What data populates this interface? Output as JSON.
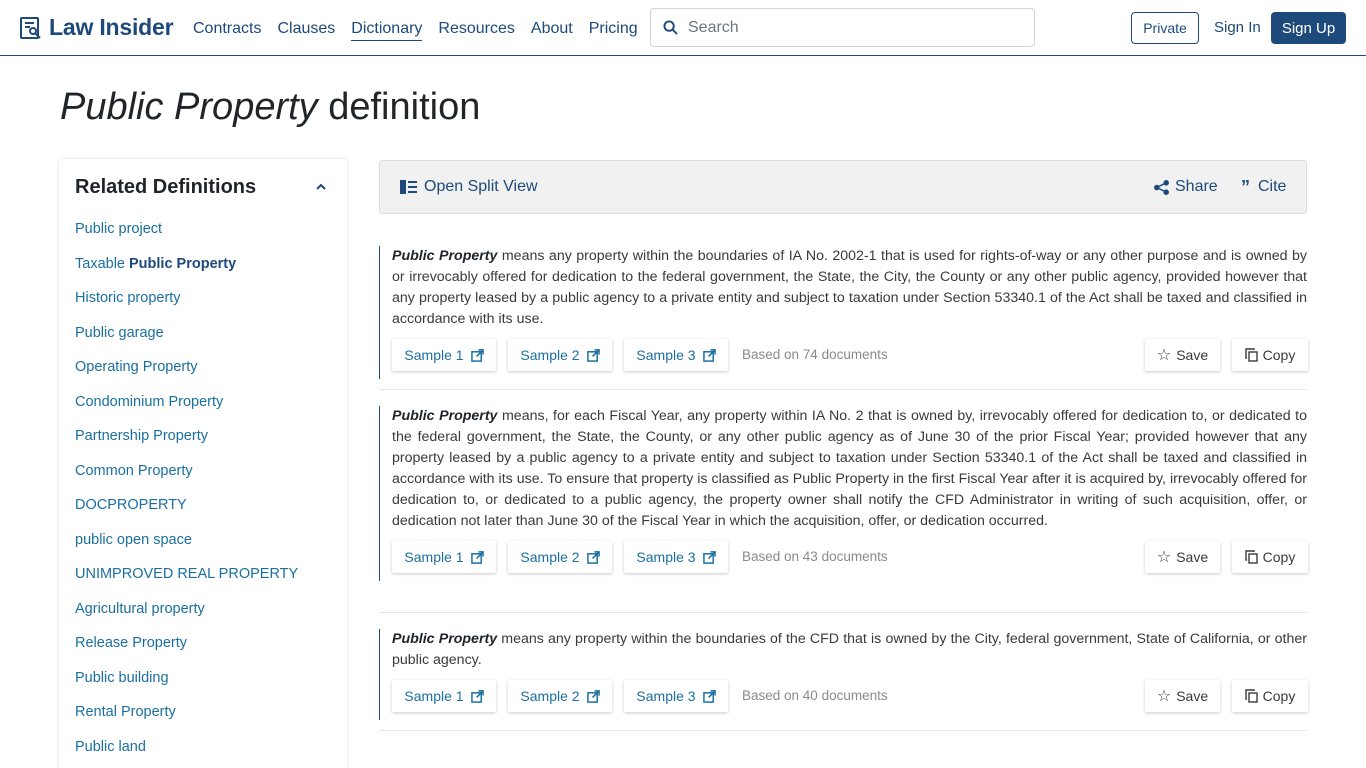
{
  "header": {
    "logo_text": "Law Insider",
    "nav": [
      "Contracts",
      "Clauses",
      "Dictionary",
      "Resources",
      "About",
      "Pricing"
    ],
    "active_nav": "Dictionary",
    "search_placeholder": "Search",
    "private_label": "Private",
    "signin_label": "Sign In",
    "signup_label": "Sign Up"
  },
  "page": {
    "title_term": "Public Property",
    "title_suffix": "definition"
  },
  "sidebar": {
    "title": "Related Definitions",
    "items": [
      {
        "prefix": "Public project",
        "bold": ""
      },
      {
        "prefix": "Taxable ",
        "bold": "Public Property"
      },
      {
        "prefix": "Historic property",
        "bold": ""
      },
      {
        "prefix": "Public garage",
        "bold": ""
      },
      {
        "prefix": "Operating Property",
        "bold": ""
      },
      {
        "prefix": "Condominium Property",
        "bold": ""
      },
      {
        "prefix": "Partnership Property",
        "bold": ""
      },
      {
        "prefix": "Common Property",
        "bold": ""
      },
      {
        "prefix": "DOCPROPERTY",
        "bold": ""
      },
      {
        "prefix": "public open space",
        "bold": ""
      },
      {
        "prefix": "UNIMPROVED REAL PROPERTY",
        "bold": ""
      },
      {
        "prefix": "Agricultural property",
        "bold": ""
      },
      {
        "prefix": "Release Property",
        "bold": ""
      },
      {
        "prefix": "Public building",
        "bold": ""
      },
      {
        "prefix": "Rental Property",
        "bold": ""
      },
      {
        "prefix": "Public land",
        "bold": ""
      }
    ]
  },
  "toolbar": {
    "split_view_label": "Open Split View",
    "share_label": "Share",
    "cite_label": "Cite"
  },
  "definitions": [
    {
      "term": "Public Property",
      "text": " means any property within the boundaries of IA No. 2002-1 that is used for rights-of-way or any other purpose and is owned by or irrevocably offered for dedication to the federal government, the State, the City, the County or any other public agency, provided however that any property leased by a public agency to a private entity and subject to taxation under Section 53340.1 of the Act shall be taxed and classified in accordance with its use.",
      "samples": [
        "Sample 1",
        "Sample 2",
        "Sample 3"
      ],
      "based_on": "Based on 74 documents",
      "save_label": "Save",
      "copy_label": "Copy"
    },
    {
      "term": "Public Property",
      "text": " means, for each Fiscal Year, any property within IA No. 2 that is owned by, irrevocably offered for dedication to, or dedicated to the federal government, the State, the County, or any other public agency as of June 30 of the prior Fiscal Year; provided however that any property leased by a public agency to a private entity and subject to taxation under Section 53340.1 of the Act shall be taxed and classified in accordance with its use. To ensure that property is classified as Public Property in the first Fiscal Year after it is acquired by, irrevocably offered for dedication to, or dedicated to a public agency, the property owner shall notify the CFD Administrator in writing of such acquisition, offer, or dedication not later than June 30 of the Fiscal Year in which the acquisition, offer, or dedication occurred.",
      "samples": [
        "Sample 1",
        "Sample 2",
        "Sample 3"
      ],
      "based_on": "Based on 43 documents",
      "save_label": "Save",
      "copy_label": "Copy"
    },
    {
      "term": "Public Property",
      "text": " means any property within the boundaries of the CFD that is owned by the City, federal government, State of California, or other public agency.",
      "samples": [
        "Sample 1",
        "Sample 2",
        "Sample 3"
      ],
      "based_on": "Based on 40 documents",
      "save_label": "Save",
      "copy_label": "Copy"
    }
  ],
  "colors": {
    "brand": "#1d4a7a",
    "link": "#1a6fa0",
    "muted": "#8a8a8a"
  }
}
